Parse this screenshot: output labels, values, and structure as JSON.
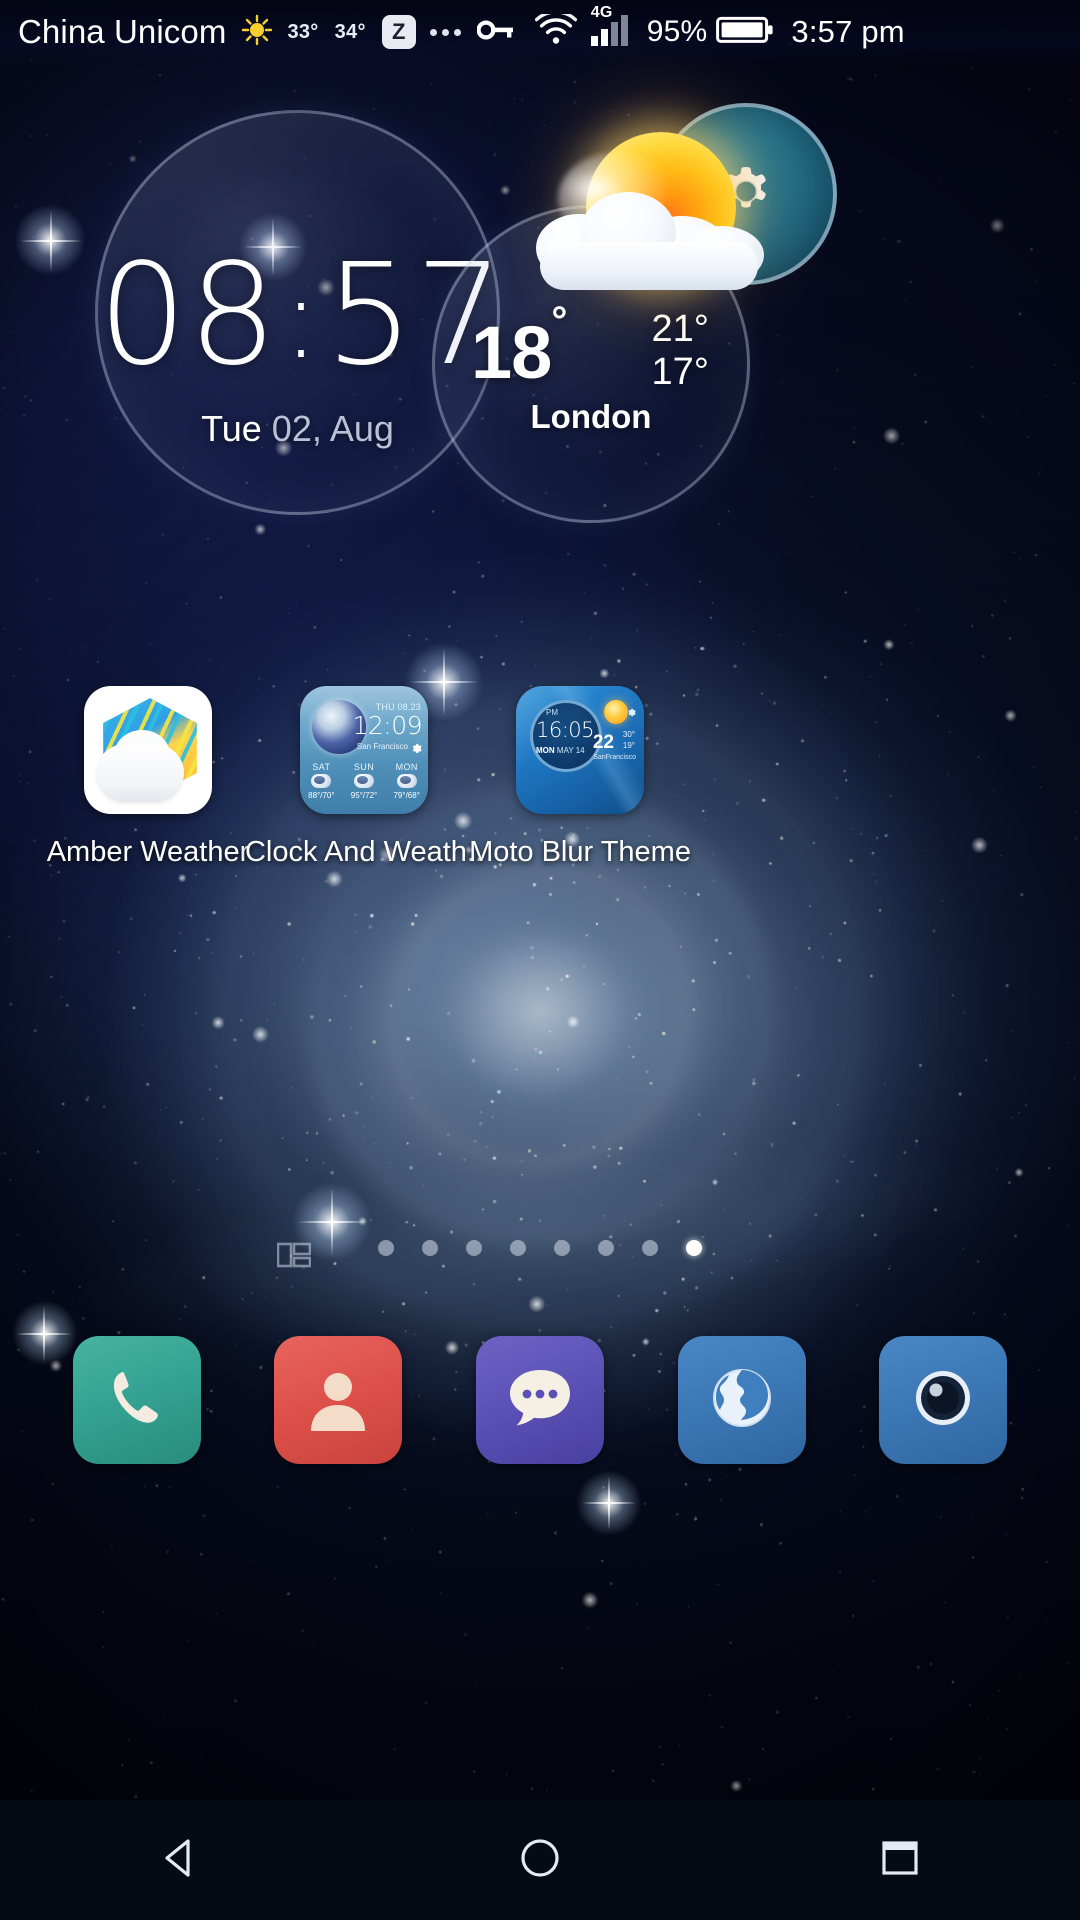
{
  "status_bar": {
    "carrier": "China Unicom",
    "weather_icon": "sun-icon",
    "temp_now": "33°",
    "temp_alt": "34°",
    "zbadge_label": "Z",
    "overflow_icon": "more-dots-icon",
    "key_icon": "vpn-key-icon",
    "wifi_icon": "wifi-icon",
    "network_type": "4G",
    "signal_icon": "signal-bars-icon",
    "battery_percent": "95%",
    "battery_icon": "battery-full-icon",
    "time": "3:57 pm"
  },
  "clock_widget": {
    "hours": "08",
    "separator": ":",
    "minutes": "57",
    "day_of_week": "Tue",
    "date": "02, Aug"
  },
  "weather_widget": {
    "icon": "sun-behind-cloud-icon",
    "current_temp": "18",
    "degree": "°",
    "high": "21°",
    "low": "17°",
    "city": "London",
    "settings_icon": "gear-icon"
  },
  "apps": [
    {
      "label": "Amber Weather",
      "icon_name": "amber-weather-icon"
    },
    {
      "label": "Clock And Weath..",
      "icon_name": "clock-and-weather-icon",
      "preview": {
        "date": "THU  08.23",
        "time": "12:09",
        "city": "San Francisco",
        "gear_icon": "gear-icon",
        "forecast": [
          {
            "day": "SAT",
            "temp": "88°/70°"
          },
          {
            "day": "SUN",
            "temp": "95°/72°"
          },
          {
            "day": "MON",
            "temp": "79°/68°"
          }
        ]
      }
    },
    {
      "label": "Moto Blur Theme",
      "icon_name": "moto-blur-theme-icon",
      "preview": {
        "meridiem": "PM",
        "time": "16:05",
        "day": "MON",
        "date": "MAY 14",
        "temp": "22",
        "high": "30°",
        "low": "19°",
        "city": "SanFrancisco",
        "gear_icon": "gear-icon"
      }
    }
  ],
  "page_indicator": {
    "total": 8,
    "active_index": 7,
    "dock_hint_icon": "home-screen-editor-icon"
  },
  "dock": [
    {
      "name": "phone",
      "icon": "phone-icon",
      "color": "#33a191"
    },
    {
      "name": "contacts",
      "icon": "contacts-icon",
      "color": "#dd4f49"
    },
    {
      "name": "messages",
      "icon": "message-bubble-icon",
      "color": "#5a4fb4"
    },
    {
      "name": "browser",
      "icon": "globe-icon",
      "color": "#3b76b4"
    },
    {
      "name": "camera",
      "icon": "camera-icon",
      "color": "#3b76b4"
    }
  ],
  "nav_bar": [
    {
      "name": "back",
      "icon": "back-triangle-icon"
    },
    {
      "name": "home",
      "icon": "home-circle-icon"
    },
    {
      "name": "recents",
      "icon": "recents-square-icon"
    }
  ],
  "colors": {
    "accent_teal": "#1f6a85",
    "sun_orange": "#ff9d10",
    "wallpaper_deep_blue": "#0d1340"
  }
}
